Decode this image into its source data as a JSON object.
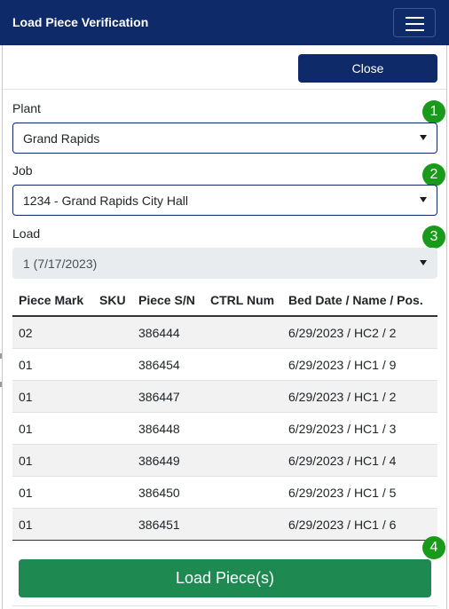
{
  "header": {
    "title": "Load Piece Verification",
    "menu_icon": "hamburger-menu-icon"
  },
  "close_button": {
    "label": "Close"
  },
  "fields": {
    "plant": {
      "label": "Plant",
      "value": "Grand Rapids",
      "step": "1"
    },
    "job": {
      "label": "Job",
      "value": "1234 - Grand Rapids City Hall",
      "step": "2"
    },
    "load": {
      "label": "Load",
      "value": "1 (7/17/2023)",
      "step": "3"
    }
  },
  "table": {
    "columns": [
      "Piece Mark",
      "SKU",
      "Piece S/N",
      "CTRL Num",
      "Bed Date / Name / Pos."
    ],
    "rows": [
      [
        "02",
        "",
        "386444",
        "",
        "6/29/2023 / HC2 / 2"
      ],
      [
        "01",
        "",
        "386454",
        "",
        "6/29/2023 / HC1 / 9"
      ],
      [
        "01",
        "",
        "386447",
        "",
        "6/29/2023 / HC1 / 2"
      ],
      [
        "01",
        "",
        "386448",
        "",
        "6/29/2023 / HC1 / 3"
      ],
      [
        "01",
        "",
        "386449",
        "",
        "6/29/2023 / HC1 / 4"
      ],
      [
        "01",
        "",
        "386450",
        "",
        "6/29/2023 / HC1 / 5"
      ],
      [
        "01",
        "",
        "386451",
        "",
        "6/29/2023 / HC1 / 6"
      ]
    ]
  },
  "load_button": {
    "label": "Load Piece(s)",
    "step": "4"
  },
  "colors": {
    "navy": "#0f2a68",
    "badge_green": "#1a9a1a",
    "load_button_green": "#1e8a52",
    "row_stripe": "#f2f2f2"
  }
}
